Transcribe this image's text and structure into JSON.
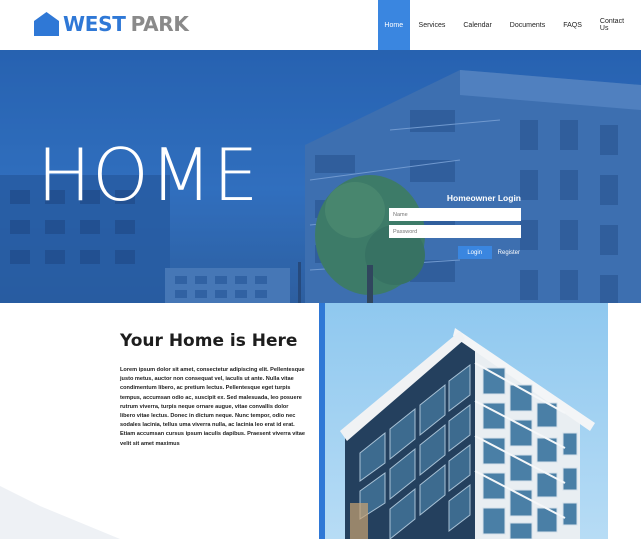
{
  "brand": {
    "name_part1": "WEST",
    "name_part2": "PARK",
    "logo_icon": "house-icon",
    "accent": "#2f78d6"
  },
  "nav": {
    "items": [
      {
        "label": "Home",
        "active": true
      },
      {
        "label": "Services",
        "active": false
      },
      {
        "label": "Calendar",
        "active": false
      },
      {
        "label": "Documents",
        "active": false
      },
      {
        "label": "FAQS",
        "active": false
      },
      {
        "label": "Contact Us",
        "active": false
      }
    ]
  },
  "hero": {
    "title": "HOME",
    "login": {
      "title": "Homeowner Login",
      "name_placeholder": "Name",
      "password_placeholder": "Password",
      "login_label": "Login",
      "register_label": "Register"
    }
  },
  "content": {
    "title": "Your Home is Here",
    "body": "Lorem ipsum dolor sit amet, consectetur adipiscing elit. Pellentesque justo metus, auctor non consequat vel, iaculis ut ante. Nulla vitae condimentum libero, ac pretium lectus. Pellentesque eget turpis tempus, accumsan odio ac, suscipit ex. Sed malesuada, leo posuere rutrum viverra, turpis neque ornare augue, vitae convallis dolor libero vitae lectus. Donec in dictum neque. Nunc tempor, odio nec sodales lacinia, tellus uma viverra nulla, ac lacinia leo erat id erat. Etiam accumsan cursus ipsum iaculis dapibus. Praesent viverra vitae velit sit amet maximus"
  }
}
